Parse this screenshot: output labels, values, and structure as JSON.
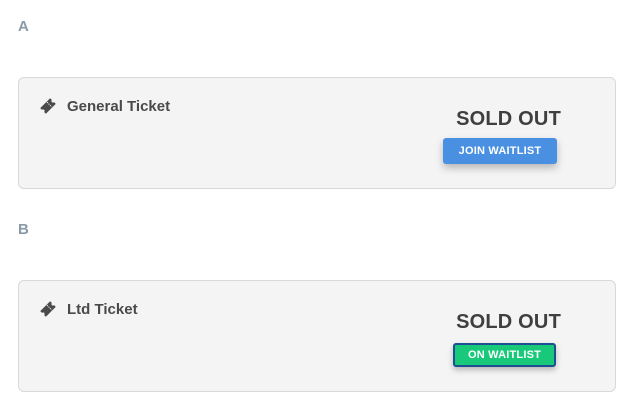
{
  "sections": [
    {
      "label": "A",
      "ticket": {
        "name": "General Ticket",
        "icon": "ticket-icon",
        "status": "SOLD OUT",
        "button_label": "JOIN WAITLIST",
        "button_color": "#4A90E2"
      }
    },
    {
      "label": "B",
      "ticket": {
        "name": "Ltd Ticket",
        "icon": "ticket-icon",
        "status": "SOLD OUT",
        "button_label": "ON WAITLIST",
        "button_color": "#18C97A"
      }
    }
  ]
}
